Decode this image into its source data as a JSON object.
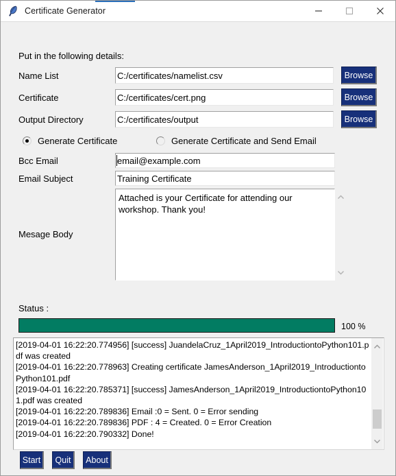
{
  "window": {
    "title": "Certificate Generator",
    "icon": "feather-icon",
    "controls": {
      "minimize": "minimize-icon",
      "maximize": "maximize-icon",
      "close": "close-icon"
    }
  },
  "form": {
    "heading": "Put in the following details:",
    "fields": [
      {
        "label": "Name List",
        "value": "C:/certificates/namelist.csv",
        "browse_label": "Browse"
      },
      {
        "label": "Certificate",
        "value": "C:/certificates/cert.png",
        "browse_label": "Browse"
      },
      {
        "label": "Output Directory",
        "value": "C:/certificates/output",
        "browse_label": "Browse"
      }
    ],
    "mode_options": [
      {
        "label": "Generate Certificate",
        "selected": true
      },
      {
        "label": "Generate Certificate and Send Email",
        "selected": false
      }
    ],
    "bcc": {
      "label": "Bcc Email",
      "value": "email@example.com"
    },
    "subject": {
      "label": "Email Subject",
      "value": "Training Certificate"
    },
    "message": {
      "label": "Mesage Body",
      "value": "Attached is your Certificate for attending our workshop. Thank you!"
    }
  },
  "status": {
    "label": "Status :",
    "percent_text": "100 %",
    "percent_value": 100,
    "bar_color": "#027c62"
  },
  "log": {
    "lines": [
      "[2019-04-01 16:22:20.774956] [success] JuandelaCruz_1April2019_IntroductiontoPython101.pdf was created",
      "[2019-04-01 16:22:20.778963] Creating certificate JamesAnderson_1April2019_IntroductiontoPython101.pdf",
      "[2019-04-01 16:22:20.785371] [success] JamesAnderson_1April2019_IntroductiontoPython101.pdf was created",
      "[2019-04-01 16:22:20.789836] Email :0 = Sent. 0 = Error sending",
      "[2019-04-01 16:22:20.789836] PDF : 4 = Created. 0 = Error Creation",
      "[2019-04-01 16:22:20.790332] Done!"
    ]
  },
  "buttons": {
    "start": "Start",
    "quit": "Quit",
    "about": "About",
    "color": "#17307a"
  }
}
